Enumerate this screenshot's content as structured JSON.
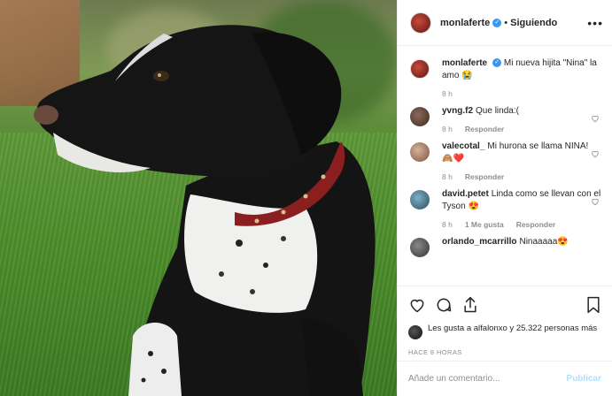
{
  "post": {
    "username": "monlaferte",
    "follow_status": "Siguiendo",
    "separator": "•",
    "caption": "Mi nueva hijita \"Nina\" la amo 😭",
    "caption_time": "8 h"
  },
  "comments": [
    {
      "username": "yvng.f2",
      "text": "Que linda:(",
      "time": "8 h",
      "likes": "",
      "reply": "Responder"
    },
    {
      "username": "valecotal_",
      "text": "Mi hurona se llama NINA! 🙈❤️",
      "time": "8 h",
      "likes": "",
      "reply": "Responder"
    },
    {
      "username": "david.petet",
      "text": "Linda como se llevan con el Tyson 😍",
      "time": "8 h",
      "likes": "1 Me gusta",
      "reply": "Responder"
    },
    {
      "username": "orlando_mcarrillo",
      "text": "Ninaaaaa😍",
      "time": "",
      "likes": "",
      "reply": ""
    }
  ],
  "likes_text": "Les gusta a alfalonxo y 25.322 personas más",
  "timestamp": "HACE 8 HORAS",
  "add_comment": {
    "placeholder": "Añade un comentario...",
    "publish": "Publicar"
  },
  "icons": {
    "more": "more-dots-icon",
    "like": "heart-icon",
    "comment": "comment-icon",
    "share": "share-icon",
    "save": "bookmark-icon",
    "verified": "verified-badge-icon"
  },
  "colors": {
    "accent": "#3897f0",
    "muted": "#8e8e8e",
    "publish_disabled": "#b2dffc"
  }
}
